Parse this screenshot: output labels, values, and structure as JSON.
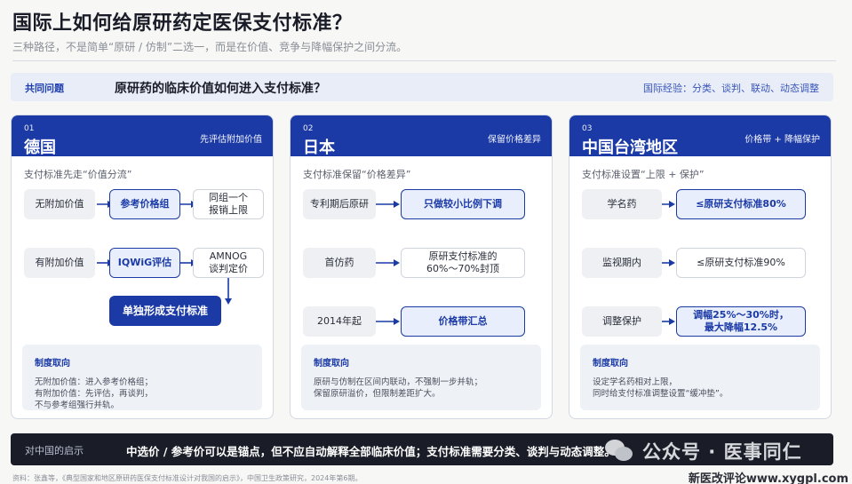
{
  "header": {
    "title": "国际上如何给原研药定医保支付标准？",
    "subtitle": "三种路径，不是简单“原研 / 仿制”二选一，而是在价值、竞争与降幅保护之间分流。"
  },
  "question": {
    "tag": "共同问题",
    "text": "原研药的临床价值如何进入支付标准？",
    "note": "国际经验：分类、谈判、联动、动态调整"
  },
  "panels": [
    {
      "num": "01",
      "name": "德国",
      "tag": "先评估附加价值",
      "subtitle": "支付标准先走“价值分流”",
      "nodes": {
        "a1": "无附加价值",
        "a2": "参考价格组",
        "a3_l1": "同组一个",
        "a3_l2": "报销上限",
        "b1": "有附加价值",
        "b2": "IQWiG评估",
        "b3_l1": "AMNOG",
        "b3_l2": "谈判定价",
        "c": "单独形成支付标准"
      },
      "policy": {
        "title": "制度取向",
        "lines": [
          "无附加价值：进入参考价格组；",
          "有附加价值：先评估，再谈判，",
          "不与参考组强行并轨。"
        ]
      }
    },
    {
      "num": "02",
      "name": "日本",
      "tag": "保留价格差异",
      "subtitle": "支付标准保留“价格差异”",
      "nodes": {
        "r1a": "专利期后原研",
        "r1b": "只做较小比例下调",
        "r2a": "首仿药",
        "r2b_l1": "原研支付标准的",
        "r2b_l2": "60%～70%封顶",
        "r3a": "2014年起",
        "r3b": "价格带汇总"
      },
      "policy": {
        "title": "制度取向",
        "lines": [
          "原研与仿制在区间内联动，不强制一步并轨；",
          "保留原研溢价，但限制差距扩大。"
        ]
      }
    },
    {
      "num": "03",
      "name": "中国台湾地区",
      "tag": "价格带 + 降幅保护",
      "subtitle": "支付标准设置“上限 + 保护”",
      "nodes": {
        "r1a": "学名药",
        "r1b": "≤原研支付标准80%",
        "r2a": "监视期内",
        "r2b": "≤原研支付标准90%",
        "r3a": "调整保护",
        "r3b_l1": "调幅25%～30%时，",
        "r3b_l2": "最大降幅12.5%"
      },
      "policy": {
        "title": "制度取向",
        "lines": [
          "设定学名药相对上限，",
          "同时给支付标准调整设置“缓冲垫”。"
        ]
      }
    }
  ],
  "footer": {
    "tag": "对中国的启示",
    "text": "中选价 / 参考价可以是锚点，但不应自动解释全部临床价值；支付标准需要分类、谈判与动态调整。"
  },
  "watermark": {
    "text": "公众号 · 医事同仁"
  },
  "source": "资料：张鑫等，《典型国家和地区原研药医保支付标准设计对我国的启示》，中国卫生政策研究，2024年第6期。",
  "site_mark": "新医改评论www.xygpl.com",
  "colors": {
    "accent": "#1b3aa6",
    "accent_light": "#e8eefc",
    "footer_bg": "#1a1d28"
  }
}
